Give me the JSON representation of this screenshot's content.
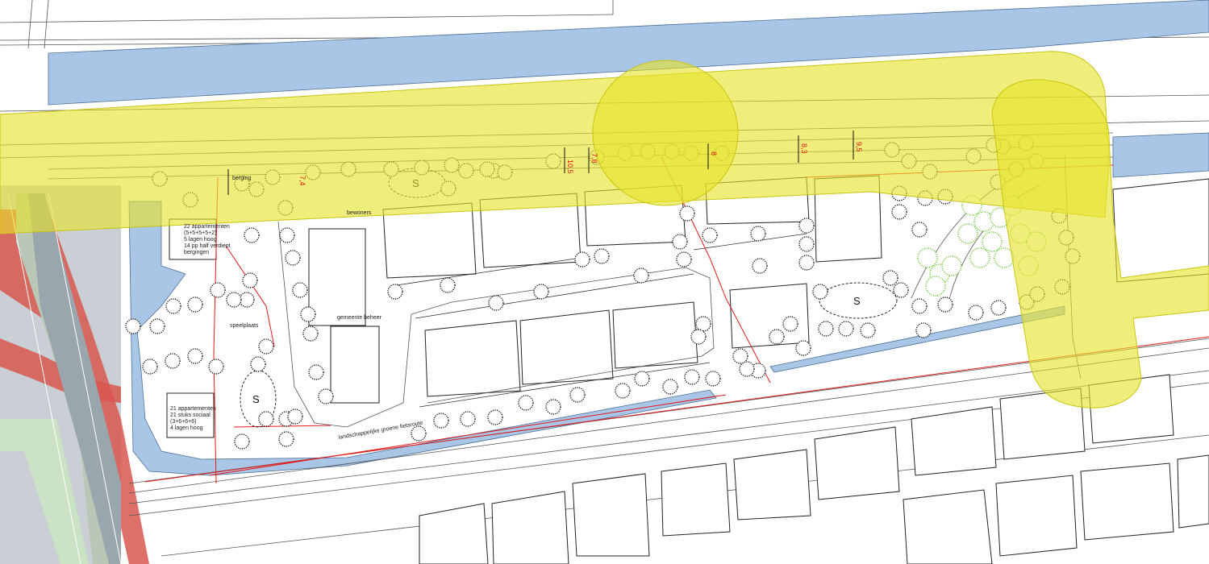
{
  "map": {
    "labels": {
      "block_north": [
        "22 appartementen",
        "(5+5+5+5+2)",
        "5 lagen hoog",
        "14 pp half verdiept",
        "bergingen"
      ],
      "block_south": [
        "21 appartementen",
        "21 stuks sociaal",
        "(3+6+6+6)",
        "4 lagen hoog"
      ],
      "parking_strip": "speelplaats",
      "path": "landschappelijke groene fietsroute",
      "small_a": "bewoners",
      "small_b": "gemeente beheer",
      "small_c": "berging"
    },
    "dimensions": [
      "7,4",
      "10,5",
      "7,8",
      "8",
      "8,3",
      "9,5"
    ],
    "green_space_symbol": "S",
    "colors": {
      "water": "#a9c6e6",
      "buffer_zone": "#e6e32a",
      "boundary": "#e41b1b",
      "highway_fill": "#c9cfd4",
      "highway_edge": "#d9574f",
      "tree_outline": "#111111",
      "green_trees": "#55c21b"
    }
  }
}
